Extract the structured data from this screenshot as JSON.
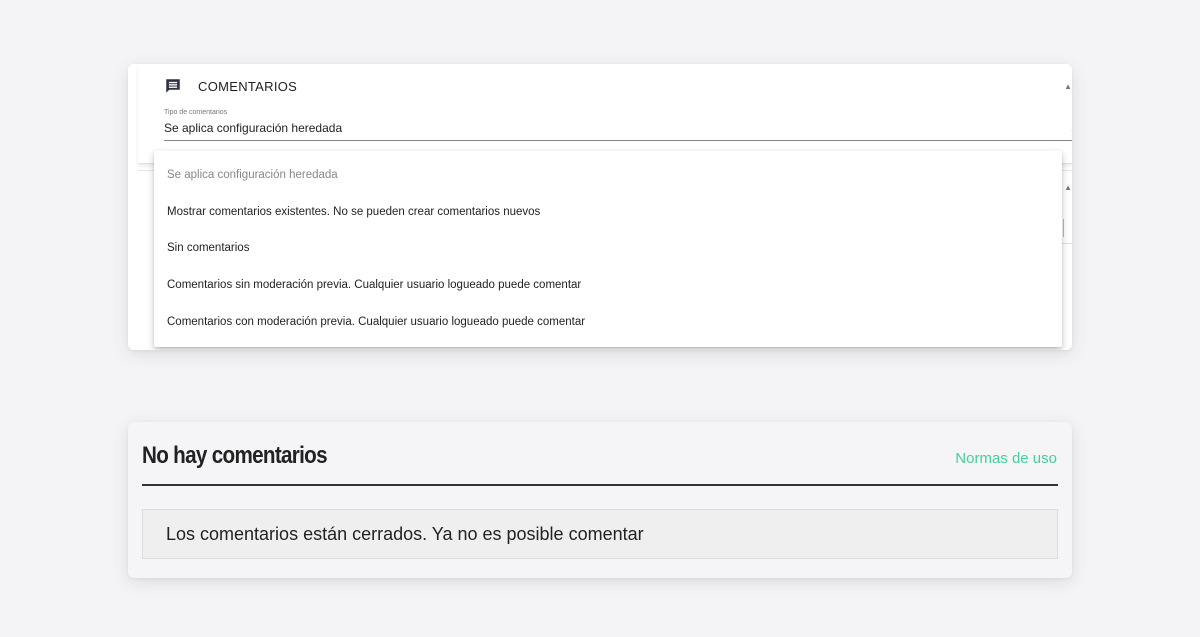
{
  "comments_panel": {
    "title": "COMENTARIOS",
    "icon": "comment-icon",
    "field_label": "Tipo de comentarios",
    "field_value": "Se aplica configuración heredada",
    "options": [
      "Se aplica configuración heredada",
      "Mostrar comentarios existentes. No se pueden crear comentarios nuevos",
      "Sin comentarios",
      "Comentarios sin moderación previa. Cualquier usuario logueado puede comentar",
      "Comentarios con moderación previa. Cualquier usuario logueado puede comentar"
    ],
    "selected_index": 0
  },
  "public_view": {
    "title": "No hay comentarios",
    "link": "Normas de uso",
    "closed_message": "Los comentarios están cerrados. Ya no es posible comentar",
    "accent_color": "#45d09a"
  }
}
